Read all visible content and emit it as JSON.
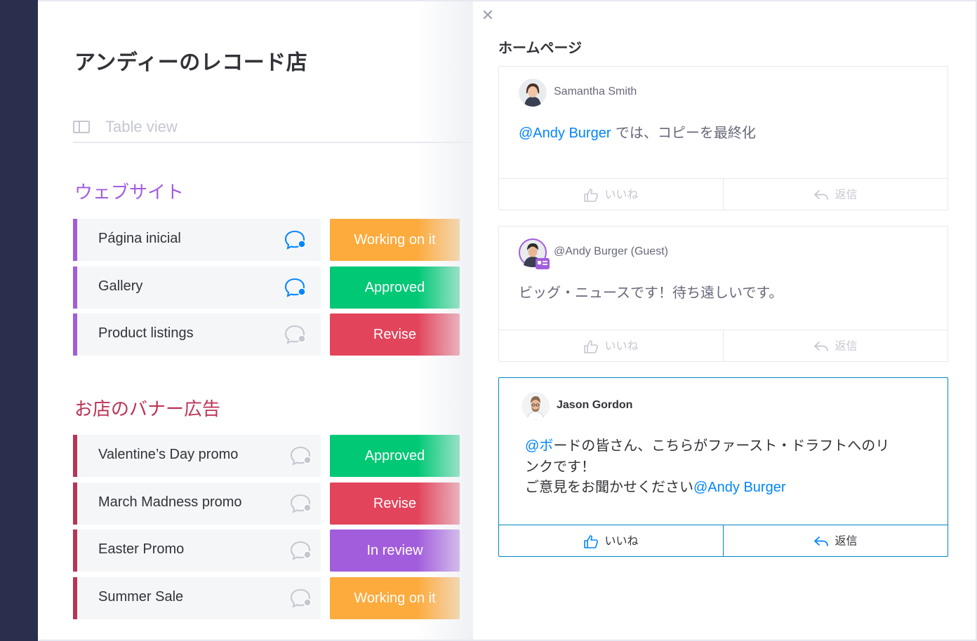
{
  "board": {
    "title": "アンディーのレコード店",
    "view_label": "Table view",
    "groups": [
      {
        "title": "ウェブサイト",
        "color": "#a25ddc",
        "rows": [
          {
            "name": "Página inicial",
            "status": "Working on it",
            "status_color": "#fdab3d",
            "has_updates": true
          },
          {
            "name": "Gallery",
            "status": "Approved",
            "status_color": "#00c875",
            "has_updates": true
          },
          {
            "name": "Product listings",
            "status": "Revise",
            "status_color": "#e2445c",
            "has_updates": false
          }
        ]
      },
      {
        "title": "お店のバナー広告",
        "color": "#bb3354",
        "rows": [
          {
            "name": "Valentine’s Day promo",
            "status": "Approved",
            "status_color": "#00c875",
            "has_updates": false
          },
          {
            "name": "March Madness promo",
            "status": "Revise",
            "status_color": "#e2445c",
            "has_updates": false
          },
          {
            "name": "Easter Promo",
            "status": "In review",
            "status_color": "#a25ddc",
            "has_updates": false
          },
          {
            "name": "Summer Sale",
            "status": "Working on it",
            "status_color": "#fdab3d",
            "has_updates": false
          }
        ]
      }
    ]
  },
  "panel": {
    "close_icon": "close-icon",
    "title": "ホームページ",
    "updates": [
      {
        "author": "Samantha Smith",
        "mention": "@Andy Burger",
        "text": " では、コピーを最終化",
        "like_label": "いいね",
        "reply_label": "返信"
      },
      {
        "author": "@Andy Burger (Guest)",
        "text": "ビッグ・ニュースです！待ち遠しいです。",
        "like_label": "いいね",
        "reply_label": "返信"
      },
      {
        "author": "Jason Gordon",
        "mention_prefix": "@ボ",
        "line1": "ードの皆さん、こちらがファースト・ドラフトへのリ",
        "line2": "ンクです！",
        "line3": "ご意見をお聞かせください",
        "mention_end": "@Andy Burger",
        "like_label": "いいね",
        "reply_label": "返信"
      }
    ]
  },
  "colors": {
    "accent": "#0085ff",
    "active_border": "#0086c0",
    "sidebar": "#292f4c"
  }
}
